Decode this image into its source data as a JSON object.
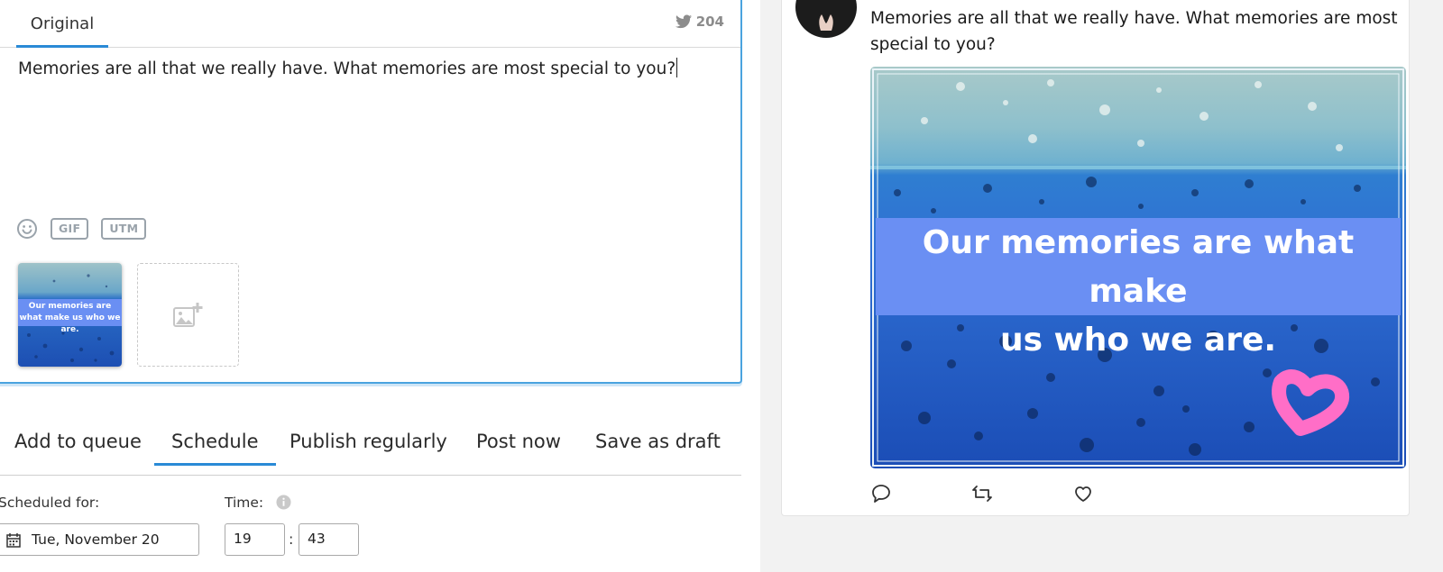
{
  "composer": {
    "tab_label": "Original",
    "char_count": "204",
    "text": "Memories are all that we really have. What memories are most special to you?",
    "tools": {
      "gif": "GIF",
      "utm": "UTM"
    },
    "thumbnail_caption": "Our memories are what make us who we are."
  },
  "actions": {
    "tabs": [
      "Add to queue",
      "Schedule",
      "Publish regularly",
      "Post now",
      "Save as draft"
    ],
    "active_tab": "Schedule"
  },
  "schedule": {
    "scheduled_label": "Scheduled for:",
    "time_label": "Time:",
    "date_value": "Tue, November 20",
    "hour": "19",
    "minute": "43",
    "separator": ":"
  },
  "preview": {
    "text": "Memories are all that we really have. What memories are most special to you?",
    "image_caption_line1": "Our memories are what make",
    "image_caption_line2": "us who we are."
  },
  "colors": {
    "accent": "#2a8ad6",
    "banner": "#6a8ff3",
    "heart_doodle": "#ff6ec7"
  },
  "icons": [
    "twitter-bird-icon",
    "smile-icon",
    "image-add-icon",
    "info-icon",
    "calendar-icon",
    "reply-icon",
    "retweet-icon",
    "like-icon"
  ]
}
